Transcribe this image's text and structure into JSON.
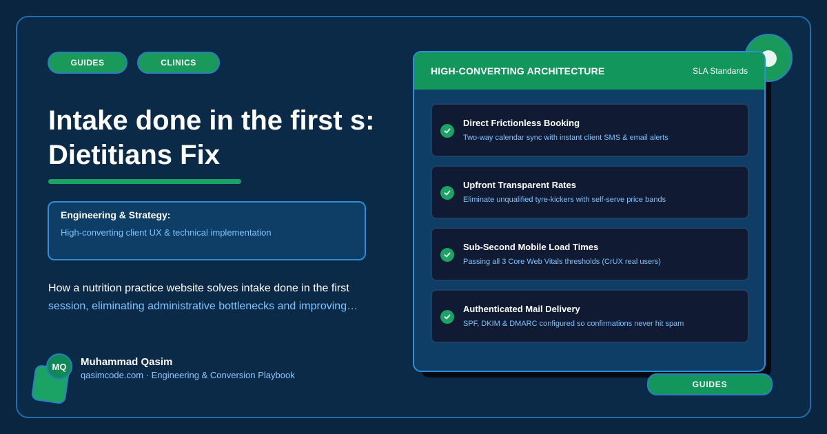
{
  "tags": [
    "GUIDES",
    "CLINICS"
  ],
  "headline": {
    "line1": "Intake done in the first s:",
    "line2": "Dietitians Fix"
  },
  "strategy": {
    "title": "Engineering & Strategy:",
    "subtitle": "High-converting client UX & technical implementation"
  },
  "description": {
    "line1": "How a nutrition practice website solves intake done in the first",
    "line2": "session, eliminating administrative bottlenecks and improving…"
  },
  "author": {
    "initials": "MQ",
    "name": "Muhammad Qasim",
    "subtitle": "qasimcode.com · Engineering & Conversion Playbook"
  },
  "card": {
    "title": "HIGH-CONVERTING ARCHITECTURE",
    "tag": "SLA Standards",
    "features": [
      {
        "title": "Direct Frictionless Booking",
        "subtitle": "Two-way calendar sync with instant client SMS & email alerts"
      },
      {
        "title": "Upfront Transparent Rates",
        "subtitle": "Eliminate unqualified tyre-kickers with self-serve price bands"
      },
      {
        "title": "Sub-Second Mobile Load Times",
        "subtitle": "Passing all 3 Core Web Vitals thresholds (CrUX real users)"
      },
      {
        "title": "Authenticated Mail Delivery",
        "subtitle": "SPF, DKIM & DMARC configured so confirmations never hit spam"
      }
    ]
  },
  "bottom_tag": "GUIDES",
  "colors": {
    "background": "#0a2540",
    "accent_green": "#1aa364",
    "border_blue": "#2d8fd6",
    "link_blue": "#7cc4ff"
  }
}
